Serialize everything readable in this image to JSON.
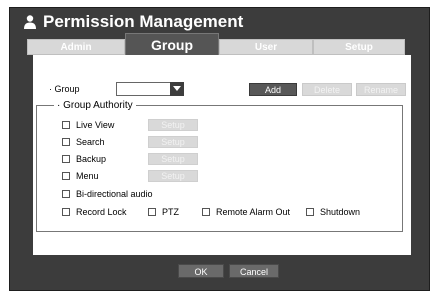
{
  "window": {
    "title": "Permission Management",
    "title_icon": "person-icon"
  },
  "tabs": [
    {
      "label": "Admin",
      "active": false
    },
    {
      "label": "Group",
      "active": true
    },
    {
      "label": "User",
      "active": false
    },
    {
      "label": "Setup",
      "active": false
    }
  ],
  "group": {
    "label": "· Group",
    "selected_value": "",
    "add_label": "Add",
    "delete_label": "Delete",
    "rename_label": "Rename"
  },
  "authority": {
    "legend": "· Group Authority",
    "items": [
      {
        "label": "Live View",
        "setup_label": "Setup",
        "checked": false
      },
      {
        "label": "Search",
        "setup_label": "Setup",
        "checked": false
      },
      {
        "label": "Backup",
        "setup_label": "Setup",
        "checked": false
      },
      {
        "label": "Menu",
        "setup_label": "Setup",
        "checked": false
      },
      {
        "label": "Bi-directional audio",
        "checked": false
      }
    ],
    "row_items": [
      {
        "label": "Record Lock",
        "checked": false
      },
      {
        "label": "PTZ",
        "checked": false
      },
      {
        "label": "Remote Alarm Out",
        "checked": false
      },
      {
        "label": "Shutdown",
        "checked": false
      }
    ]
  },
  "footer": {
    "ok_label": "OK",
    "cancel_label": "Cancel"
  },
  "colors": {
    "dialog_bg": "#3c3c3c",
    "active_tab": "#555555",
    "inactive_tab": "#d8d8d8",
    "dark_button": "#585858"
  }
}
